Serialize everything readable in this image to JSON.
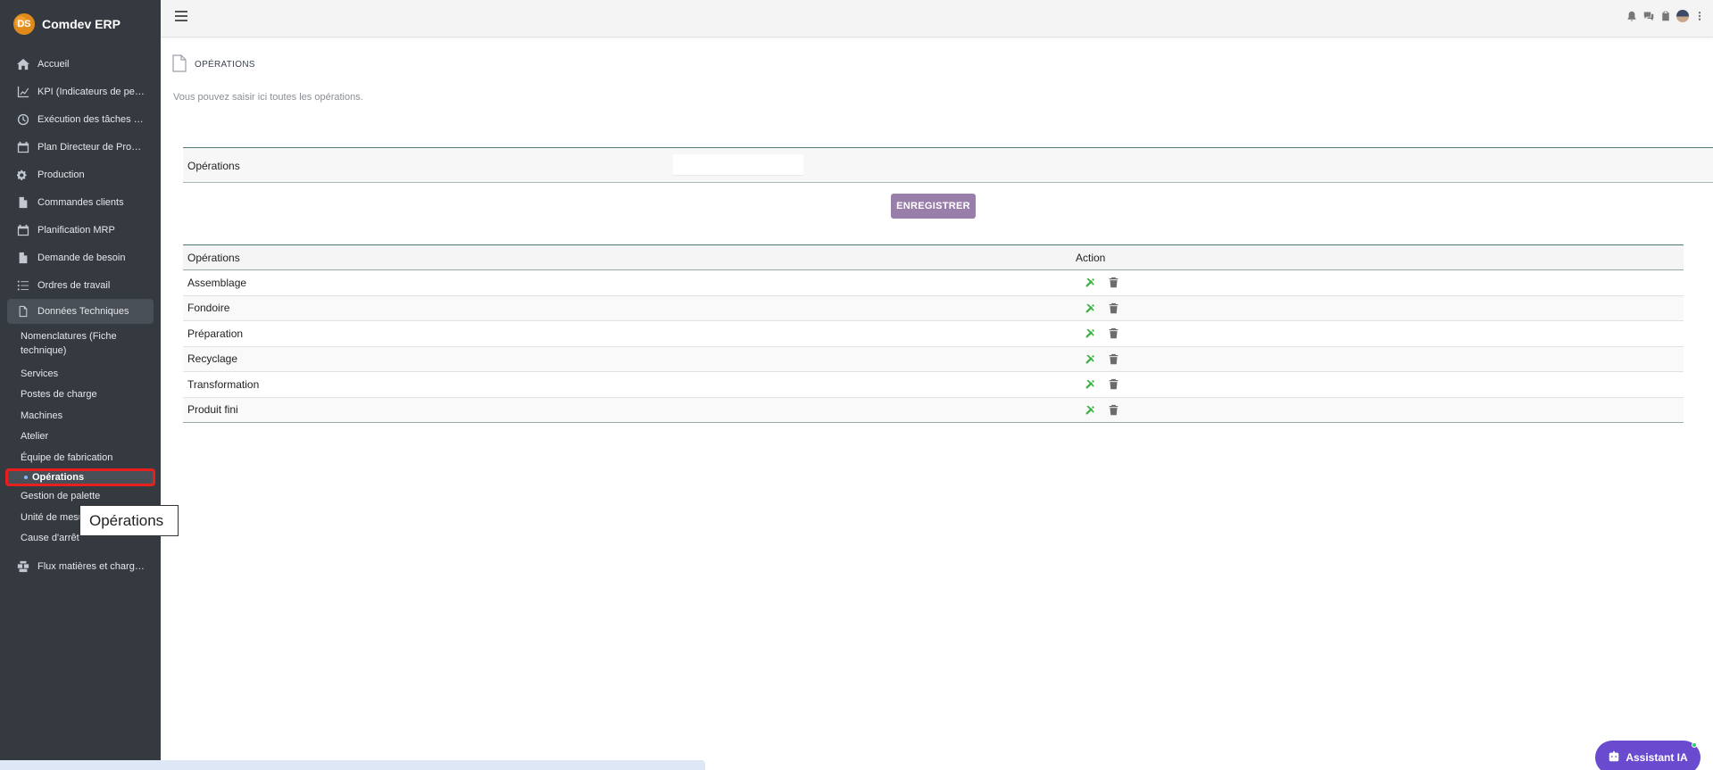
{
  "brand": {
    "name": "Comdev ERP",
    "logo_text": "DS"
  },
  "sidebar": {
    "items": [
      {
        "label": "Accueil",
        "icon": "home-icon"
      },
      {
        "label": "KPI (Indicateurs de perf…",
        "icon": "chart-line-icon"
      },
      {
        "label": "Exécution des tâches d'…",
        "icon": "clock-icon"
      },
      {
        "label": "Plan Directeur de Productio",
        "icon": "calendar-icon"
      },
      {
        "label": "Production",
        "icon": "gears-icon"
      },
      {
        "label": "Commandes clients",
        "icon": "file-icon"
      },
      {
        "label": "Planification MRP",
        "icon": "calendar-icon"
      },
      {
        "label": "Demande de besoin",
        "icon": "file-icon"
      },
      {
        "label": "Ordres de travail",
        "icon": "tasks-icon"
      },
      {
        "label": "Données Techniques",
        "icon": "file-outline-icon"
      }
    ],
    "sub_items": [
      {
        "label": "Nomenclatures (Fiche technique)"
      },
      {
        "label": "Services"
      },
      {
        "label": "Postes de charge"
      },
      {
        "label": "Machines"
      },
      {
        "label": "Atelier"
      },
      {
        "label": "Équipe de fabrication"
      },
      {
        "label": "Opérations"
      },
      {
        "label": "Gestion de palette"
      },
      {
        "label": "Unité de mesu"
      },
      {
        "label": "Cause d'arrêt"
      }
    ],
    "last_item": {
      "label": "Flux matières et charges",
      "icon": "boxes-icon"
    }
  },
  "tooltip": {
    "text": "Opérations"
  },
  "page": {
    "title": "OPÉRATIONS",
    "description": "Vous pouvez saisir ici toutes les opérations."
  },
  "form": {
    "label": "Opérations",
    "value": "",
    "save_label": "ENREGISTRER"
  },
  "table": {
    "headers": [
      "Opérations",
      "Action"
    ],
    "rows": [
      {
        "name": "Assemblage"
      },
      {
        "name": "Fondoire"
      },
      {
        "name": "Préparation"
      },
      {
        "name": "Recyclage"
      },
      {
        "name": "Transformation"
      },
      {
        "name": "Produit fini"
      }
    ]
  },
  "assistant": {
    "label": "Assistant IA"
  },
  "colors": {
    "sidebar_bg": "#343a40",
    "accent": "#9a7eaa",
    "assistant": "#6a4bd0",
    "edit_green": "#3cb043"
  }
}
